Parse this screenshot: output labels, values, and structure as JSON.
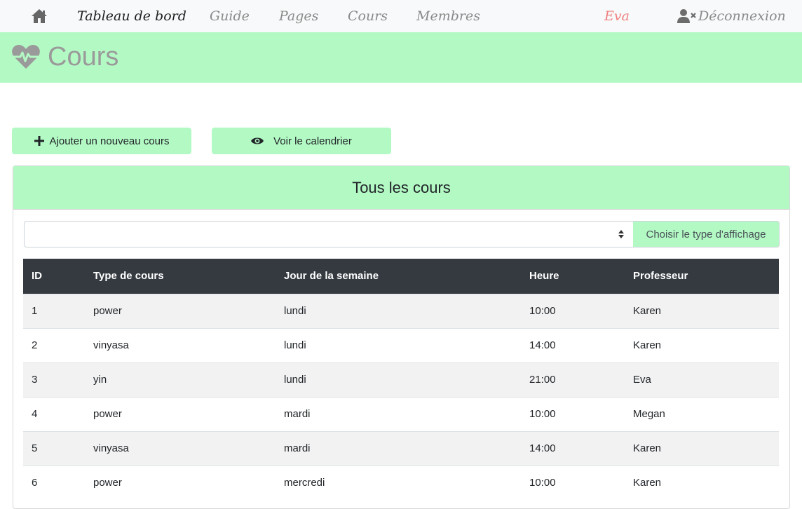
{
  "nav": {
    "home_icon": "home-icon",
    "links": [
      {
        "label": "Tableau de bord",
        "active": true
      },
      {
        "label": "Guide",
        "active": false
      },
      {
        "label": "Pages",
        "active": false
      },
      {
        "label": "Cours",
        "active": false
      },
      {
        "label": "Membres",
        "active": false
      }
    ],
    "user": "Eva",
    "logout_label": "Déconnexion",
    "logout_icon": "user-times-icon"
  },
  "header": {
    "icon": "heartbeat-icon",
    "title": "Cours"
  },
  "actions": {
    "add_label": "Ajouter un nouveau cours",
    "add_icon": "plus-icon",
    "calendar_label": "Voir le calendrier",
    "calendar_icon": "eye-icon"
  },
  "card": {
    "title": "Tous les cours",
    "select": {
      "value": "",
      "button_label": "Choisir le type d'affichage"
    },
    "table": {
      "columns": [
        "ID",
        "Type de cours",
        "Jour de la semaine",
        "Heure",
        "Professeur"
      ],
      "rows": [
        [
          "1",
          "power",
          "lundi",
          "10:00",
          "Karen"
        ],
        [
          "2",
          "vinyasa",
          "lundi",
          "14:00",
          "Karen"
        ],
        [
          "3",
          "yin",
          "lundi",
          "21:00",
          "Eva"
        ],
        [
          "4",
          "power",
          "mardi",
          "10:00",
          "Megan"
        ],
        [
          "5",
          "vinyasa",
          "mardi",
          "14:00",
          "Karen"
        ],
        [
          "6",
          "power",
          "mercredi",
          "10:00",
          "Karen"
        ]
      ]
    }
  },
  "colors": {
    "accent": "#b3f9c4",
    "table_header": "#343a40",
    "user": "#f08080"
  }
}
